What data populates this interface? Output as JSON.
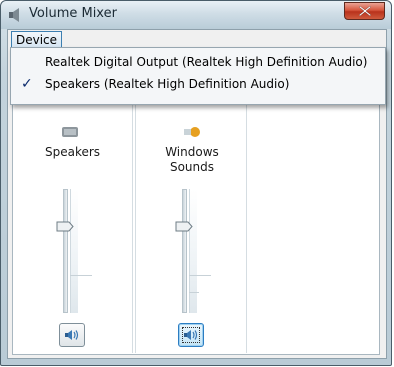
{
  "window": {
    "title": "Volume Mixer"
  },
  "menubar": {
    "device_label": "Device"
  },
  "device_menu": {
    "items": [
      {
        "label": "Realtek Digital Output (Realtek High Definition Audio)",
        "checked": false
      },
      {
        "label": "Speakers (Realtek High Definition Audio)",
        "checked": true
      }
    ],
    "check_glyph": "✓"
  },
  "channels": [
    {
      "label": "Speakers",
      "icon": "speaker-icon",
      "level": 0.72,
      "muted": false
    },
    {
      "label": "Windows\nSounds",
      "icon": "windows-sounds-icon",
      "level": 0.72,
      "muted": false
    }
  ],
  "colors": {
    "titlebar": "#cfdde6",
    "close": "#c94a33",
    "focus_blue": "#2c7dc2"
  }
}
